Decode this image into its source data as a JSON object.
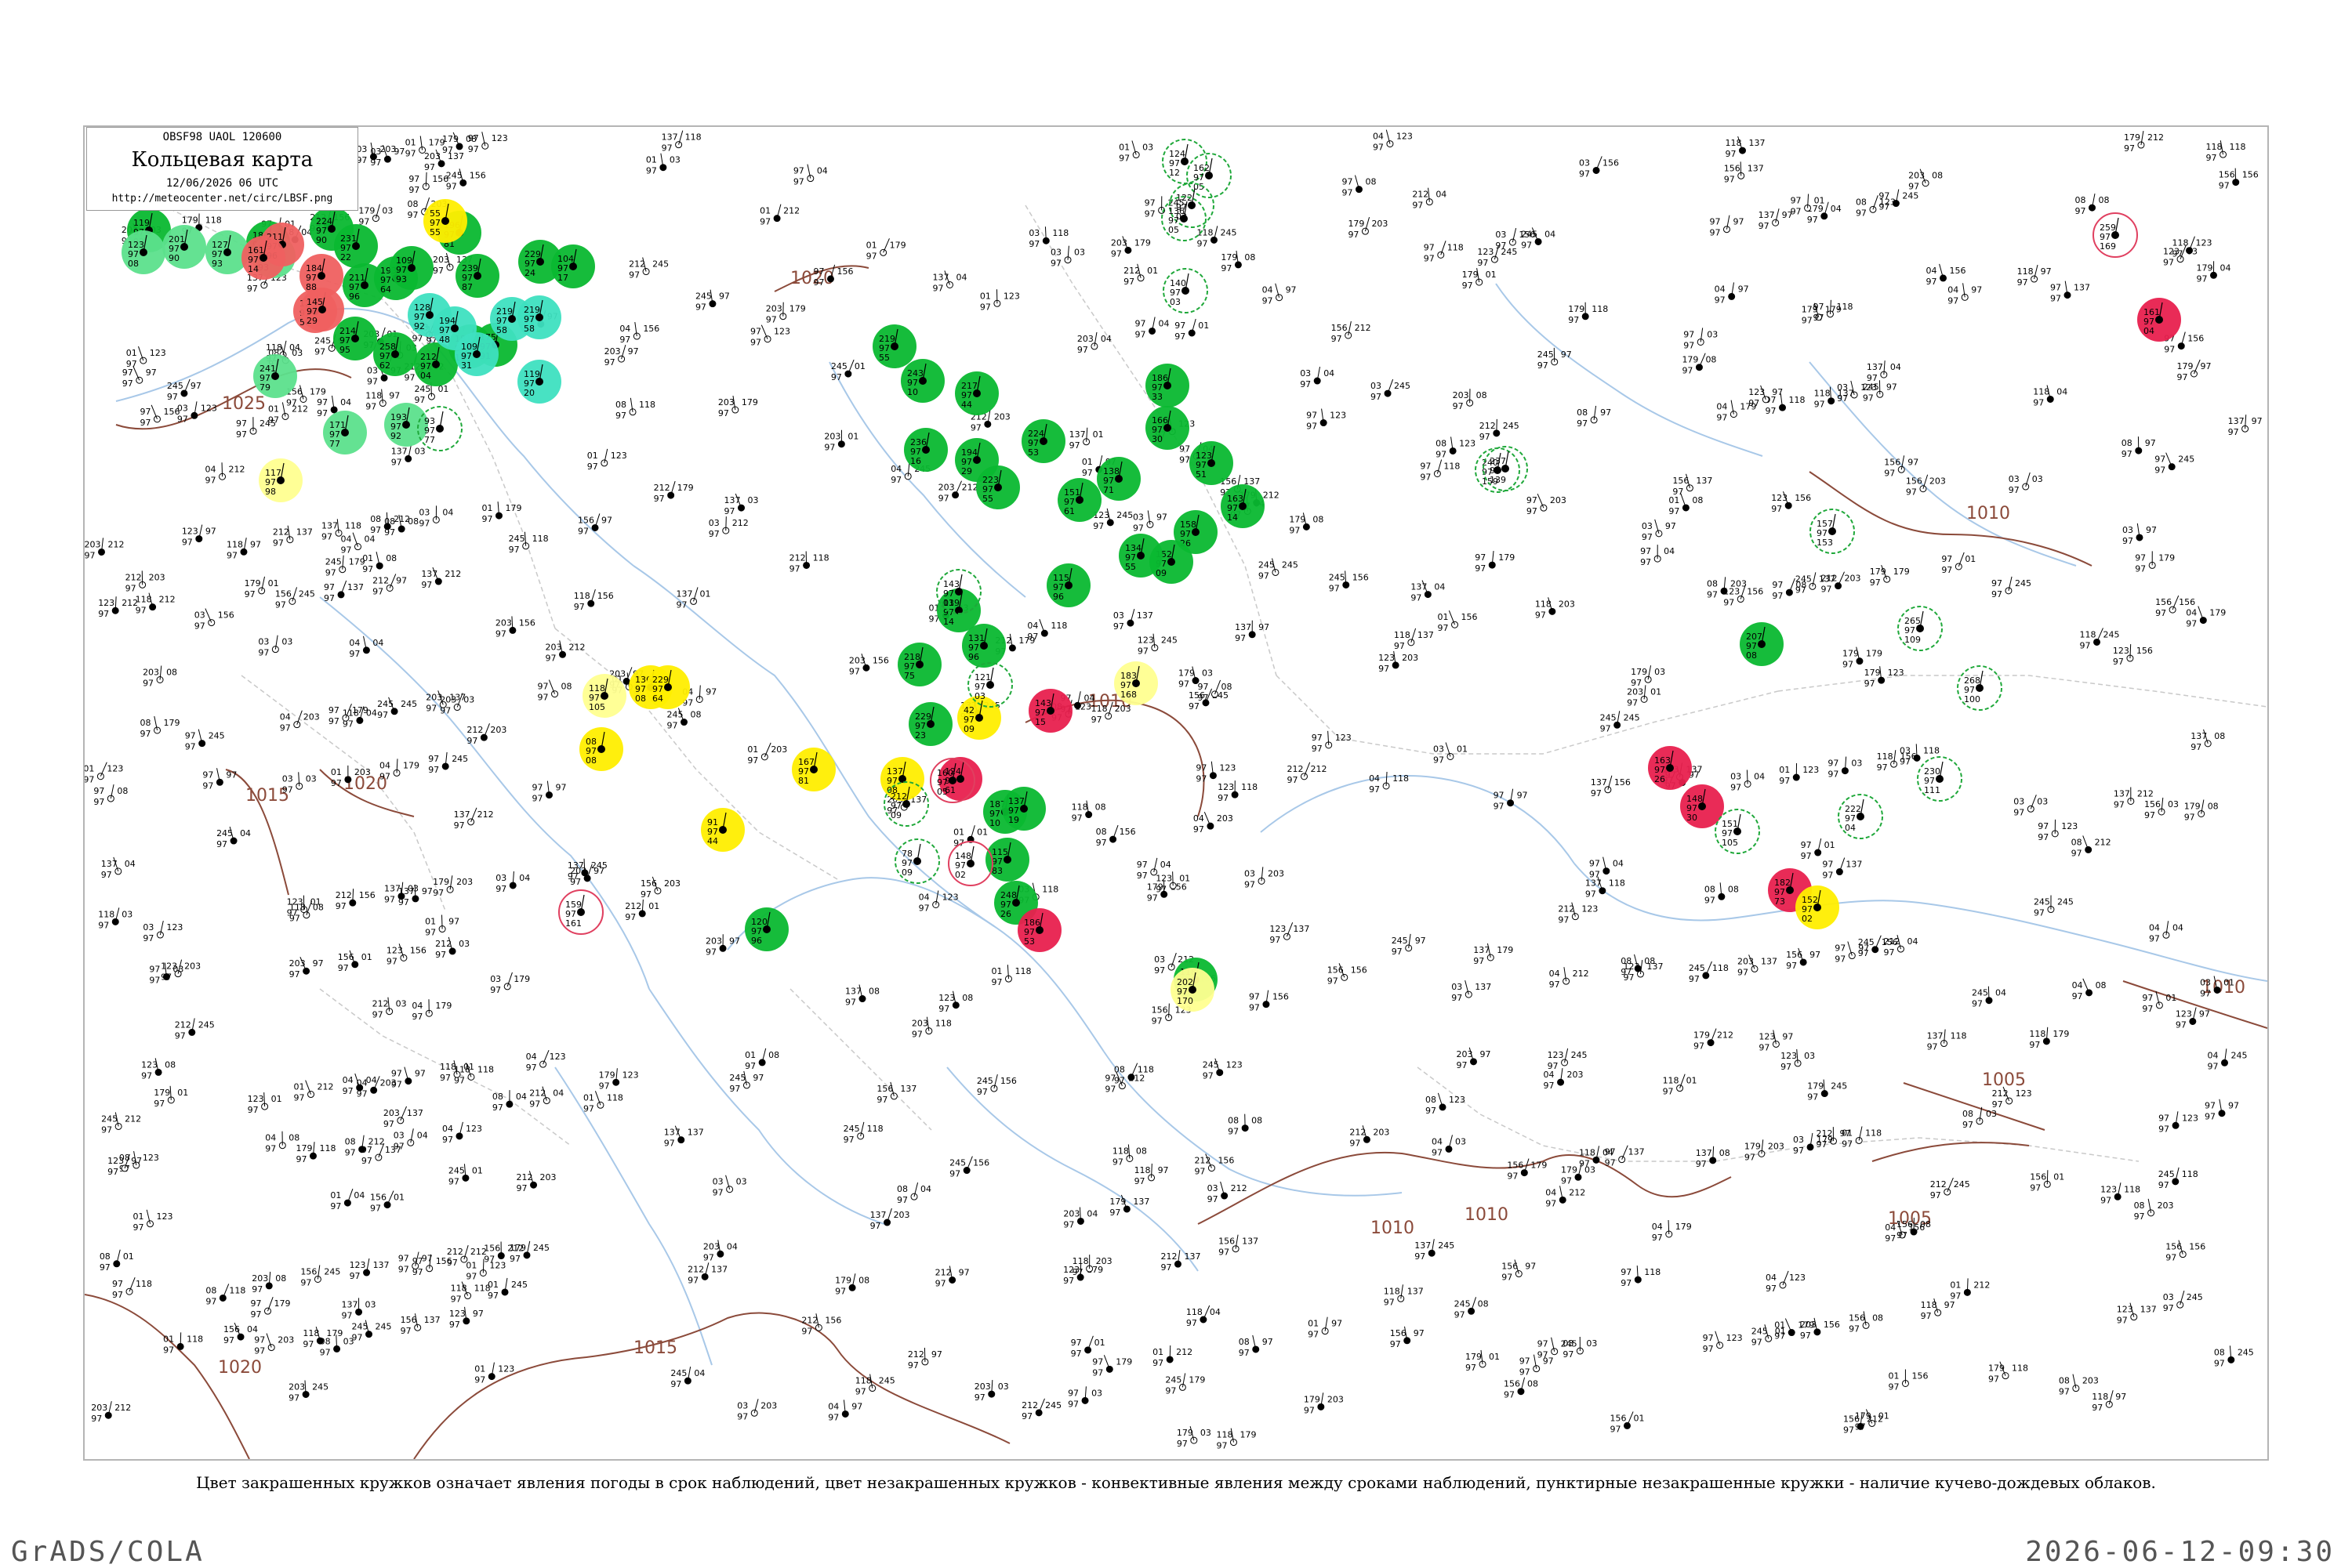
{
  "header": {
    "code_line": "OBSF98  UAOL  120600",
    "title": "Кольцевая карта",
    "datetime": "12/06/2026 06 UTC",
    "url": "http://meteocenter.net/circ/LBSF.png"
  },
  "caption": "Цвет закрашенных кружков означает явления погоды в срок наблюдений, цвет незакрашенных кружков - конвективные явления между сроками наблюдений, пунктирные незакрашенные кружки - наличие кучево-дождевых облаков.",
  "footer": {
    "left": "GrADS/COLA",
    "right": "2026-06-12-09:30"
  },
  "colors": {
    "isobar": "#8b4a3a",
    "coast": "#a8c8e8",
    "border": "#c9c9c9",
    "green_fill": "#0ab830",
    "light_green_fill": "#5ce08c",
    "teal_fill": "#3ee0c0",
    "red_fill": "#ef6060",
    "crimson_fill": "#e8204e",
    "yellow_fill": "#ffee00",
    "pale_yellow_fill": "#ffff90",
    "open_green_ring": "#1fa83a",
    "open_red_ring": "#e04060"
  },
  "isobars": [
    {
      "label": "1025"
    },
    {
      "label": "1020"
    },
    {
      "label": "1020"
    },
    {
      "label": "1020"
    },
    {
      "label": "1015"
    },
    {
      "label": "1015"
    },
    {
      "label": "1010"
    },
    {
      "label": "1010"
    },
    {
      "label": "1010"
    },
    {
      "label": "1010"
    },
    {
      "label": "1010"
    },
    {
      "label": "1005"
    },
    {
      "label": "1005"
    }
  ],
  "stations": [
    {
      "type": "green",
      "t": "119",
      "b": "97",
      "c": "92"
    },
    {
      "type": "green",
      "t": "184",
      "b": "97",
      "c": "65"
    },
    {
      "type": "green",
      "t": "224",
      "b": "97",
      "c": "90"
    },
    {
      "type": "green",
      "t": "231",
      "b": "97",
      "c": "22"
    },
    {
      "type": "green",
      "t": "211",
      "b": "97",
      "c": "96"
    },
    {
      "type": "green",
      "t": "193",
      "b": "97",
      "c": "64"
    },
    {
      "type": "green",
      "t": "109",
      "b": "97",
      "c": "93"
    },
    {
      "type": "green",
      "t": "196",
      "b": "97",
      "c": "81"
    },
    {
      "type": "green",
      "t": "239",
      "b": "97",
      "c": "87"
    },
    {
      "type": "green",
      "t": "229",
      "b": "97",
      "c": "24"
    },
    {
      "type": "green",
      "t": "104",
      "b": "97",
      "c": "17"
    },
    {
      "type": "green",
      "t": "214",
      "b": "97",
      "c": "95"
    },
    {
      "type": "green",
      "t": "258",
      "b": "97",
      "c": "62"
    },
    {
      "type": "green",
      "t": "212",
      "b": "97",
      "c": "04"
    },
    {
      "type": "green",
      "t": "181",
      "b": "97",
      "c": "16"
    },
    {
      "type": "green",
      "t": "175",
      "b": "97",
      "c": "91"
    },
    {
      "type": "green",
      "t": "219",
      "b": "97",
      "c": "55"
    },
    {
      "type": "green",
      "t": "243",
      "b": "97",
      "c": "10"
    },
    {
      "type": "green",
      "t": "217",
      "b": "97",
      "c": "44"
    },
    {
      "type": "green",
      "t": "236",
      "b": "97",
      "c": "16"
    },
    {
      "type": "green",
      "t": "194",
      "b": "97",
      "c": "29"
    },
    {
      "type": "green",
      "t": "223",
      "b": "97",
      "c": "55"
    },
    {
      "type": "green",
      "t": "224",
      "b": "97",
      "c": "53"
    },
    {
      "type": "green",
      "t": "151",
      "b": "97",
      "c": "61"
    },
    {
      "type": "green",
      "t": "138",
      "b": "97",
      "c": "71"
    },
    {
      "type": "green",
      "t": "186",
      "b": "97",
      "c": "33"
    },
    {
      "type": "green",
      "t": "166",
      "b": "97",
      "c": "30"
    },
    {
      "type": "green",
      "t": "123",
      "b": "97",
      "c": "51"
    },
    {
      "type": "green",
      "t": "158",
      "b": "97",
      "c": "26"
    },
    {
      "type": "green",
      "t": "163",
      "b": "97",
      "c": "14"
    },
    {
      "type": "green",
      "t": "152",
      "b": "97",
      "c": "09"
    },
    {
      "type": "green",
      "t": "134",
      "b": "97",
      "c": "55"
    },
    {
      "type": "green",
      "t": "115",
      "b": "97",
      "c": "96"
    },
    {
      "type": "green",
      "t": "139",
      "b": "97",
      "c": "14"
    },
    {
      "type": "green",
      "t": "131",
      "b": "97",
      "c": "96"
    },
    {
      "type": "green",
      "t": "218",
      "b": "97",
      "c": "75"
    },
    {
      "type": "green",
      "t": "229",
      "b": "97",
      "c": "23"
    },
    {
      "type": "green",
      "t": "187",
      "b": "97",
      "c": "10"
    },
    {
      "type": "green",
      "t": "115",
      "b": "97",
      "c": "83"
    },
    {
      "type": "green",
      "t": "248",
      "b": "97",
      "c": "26"
    },
    {
      "type": "green",
      "t": "120",
      "b": "97",
      "c": "96"
    },
    {
      "type": "green",
      "t": "118",
      "b": "97",
      "c": "04"
    },
    {
      "type": "green",
      "t": "207",
      "b": "97",
      "c": "08"
    },
    {
      "type": "green",
      "t": "137",
      "b": "97",
      "c": "19"
    },
    {
      "type": "light_green",
      "t": "123",
      "b": "97",
      "c": "08"
    },
    {
      "type": "light_green",
      "t": "201",
      "b": "97",
      "c": "90"
    },
    {
      "type": "light_green",
      "t": "127",
      "b": "97",
      "c": "93"
    },
    {
      "type": "light_green",
      "t": "255",
      "b": "97",
      "c": "93"
    },
    {
      "type": "light_green",
      "t": "241",
      "b": "97",
      "c": "79"
    },
    {
      "type": "light_green",
      "t": "171",
      "b": "97",
      "c": "77"
    },
    {
      "type": "light_green",
      "t": "193",
      "b": "97",
      "c": "92"
    },
    {
      "type": "teal",
      "t": "128",
      "b": "97",
      "c": "92"
    },
    {
      "type": "teal",
      "t": "194",
      "b": "97",
      "c": "48"
    },
    {
      "type": "teal",
      "t": "109",
      "b": "97",
      "c": "31"
    },
    {
      "type": "teal",
      "t": "219",
      "b": "97",
      "c": "58"
    },
    {
      "type": "teal",
      "t": "219",
      "b": "97",
      "c": "58"
    },
    {
      "type": "teal",
      "t": "119",
      "b": "97",
      "c": "20"
    },
    {
      "type": "red",
      "t": "211",
      "b": "97",
      "c": "96"
    },
    {
      "type": "red",
      "t": "161",
      "b": "97",
      "c": "14"
    },
    {
      "type": "red",
      "t": "123",
      "b": "97",
      "c": "50"
    },
    {
      "type": "red",
      "t": "145",
      "b": "97",
      "c": "29"
    },
    {
      "type": "red",
      "t": "184",
      "b": "97",
      "c": "88"
    },
    {
      "type": "crimson",
      "t": "161",
      "b": "97",
      "c": "04"
    },
    {
      "type": "crimson",
      "t": "163",
      "b": "97",
      "c": "26"
    },
    {
      "type": "crimson",
      "t": "148",
      "b": "97",
      "c": "30"
    },
    {
      "type": "crimson",
      "t": "124",
      "b": "97",
      "c": "61"
    },
    {
      "type": "crimson",
      "t": "186",
      "b": "97",
      "c": "53"
    },
    {
      "type": "crimson",
      "t": "143",
      "b": "97",
      "c": "15"
    },
    {
      "type": "crimson",
      "t": "182",
      "b": "97",
      "c": "73"
    },
    {
      "type": "yellow",
      "t": "55",
      "b": "97",
      "c": "55"
    },
    {
      "type": "yellow",
      "t": "136",
      "b": "97",
      "c": "08"
    },
    {
      "type": "yellow",
      "t": "229",
      "b": "97",
      "c": "64"
    },
    {
      "type": "yellow",
      "t": "08",
      "b": "97",
      "c": "08"
    },
    {
      "type": "yellow",
      "t": "91",
      "b": "97",
      "c": "44"
    },
    {
      "type": "yellow",
      "t": "167",
      "b": "97",
      "c": "81"
    },
    {
      "type": "yellow",
      "t": "137",
      "b": "97",
      "c": "08"
    },
    {
      "type": "yellow",
      "t": "42",
      "b": "97",
      "c": "09"
    },
    {
      "type": "yellow",
      "t": "152",
      "b": "97",
      "c": "02"
    },
    {
      "type": "pale_yellow",
      "t": "117",
      "b": "97",
      "c": "98"
    },
    {
      "type": "pale_yellow",
      "t": "118",
      "b": "97",
      "c": "105"
    },
    {
      "type": "pale_yellow",
      "t": "183",
      "b": "97",
      "c": "168"
    },
    {
      "type": "pale_yellow",
      "t": "202",
      "b": "97",
      "c": "170"
    },
    {
      "type": "open_green",
      "t": "124",
      "b": "97",
      "c": "12"
    },
    {
      "type": "open_green",
      "t": "162",
      "b": "97",
      "c": "05"
    },
    {
      "type": "open_green",
      "t": "122",
      "b": "97",
      "c": "03"
    },
    {
      "type": "open_green",
      "t": "136",
      "b": "97",
      "c": "05"
    },
    {
      "type": "open_green",
      "t": "140",
      "b": "97",
      "c": "03"
    },
    {
      "type": "open_green",
      "t": "93",
      "b": "97",
      "c": "77"
    },
    {
      "type": "open_green",
      "t": "240",
      "b": "97",
      "c": "159"
    },
    {
      "type": "open_green",
      "t": "237",
      "b": "97",
      "c": "139"
    },
    {
      "type": "open_green",
      "t": "157",
      "b": "97",
      "c": "153"
    },
    {
      "type": "open_green",
      "t": "143",
      "b": "97",
      "c": "01"
    },
    {
      "type": "open_green",
      "t": "121",
      "b": "97",
      "c": "03"
    },
    {
      "type": "open_green",
      "t": "265",
      "b": "97",
      "c": "109"
    },
    {
      "type": "open_green",
      "t": "268",
      "b": "97",
      "c": "100"
    },
    {
      "type": "open_green",
      "t": "230",
      "b": "97",
      "c": "111"
    },
    {
      "type": "open_green",
      "t": "151",
      "b": "97",
      "c": "105"
    },
    {
      "type": "open_green",
      "t": "222",
      "b": "97",
      "c": "04"
    },
    {
      "type": "open_green",
      "t": "78",
      "b": "97",
      "c": "09"
    },
    {
      "type": "open_green",
      "t": "212",
      "b": "97",
      "c": "09"
    },
    {
      "type": "open_red",
      "t": "159",
      "b": "97",
      "c": "161"
    },
    {
      "type": "open_red",
      "t": "259",
      "b": "97",
      "c": "169"
    },
    {
      "type": "open_red",
      "t": "160",
      "b": "97",
      "c": "05"
    },
    {
      "type": "open_red",
      "t": "148",
      "b": "97",
      "c": "02"
    }
  ]
}
